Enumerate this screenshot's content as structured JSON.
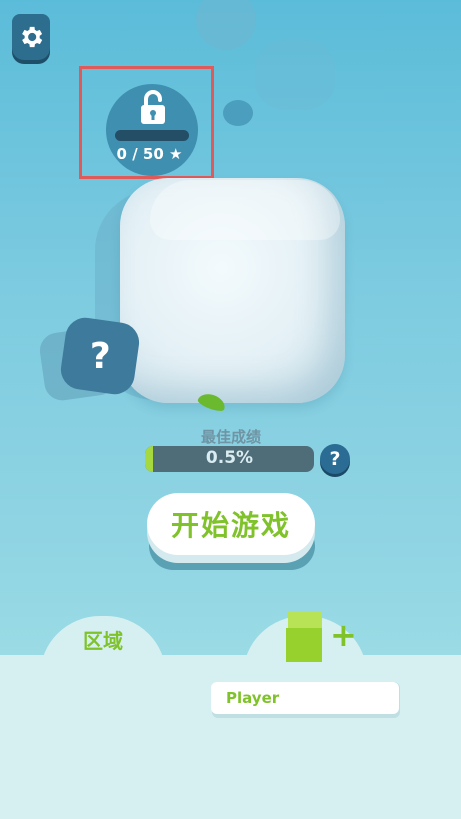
{
  "lock": {
    "progress_text": "0 / 50 ★",
    "current": 0,
    "total": 50
  },
  "best_score": {
    "label": "最佳成绩",
    "value_text": "0.5%",
    "value": 0.005
  },
  "question_glyph": "?",
  "help_glyph": "?",
  "start_button": {
    "label": "开始游戏"
  },
  "tabs": {
    "zone_label": "区域",
    "add_glyph": "+"
  },
  "player": {
    "name": "Player"
  },
  "colors": {
    "accent_green": "#7fc22a",
    "lock_highlight": "#e05a5a",
    "bg_blue": "#5bbcd9"
  },
  "icons": [
    "gear-icon",
    "unlock-icon",
    "question-icon",
    "help-icon",
    "skin-cube-icon",
    "plus-icon"
  ]
}
